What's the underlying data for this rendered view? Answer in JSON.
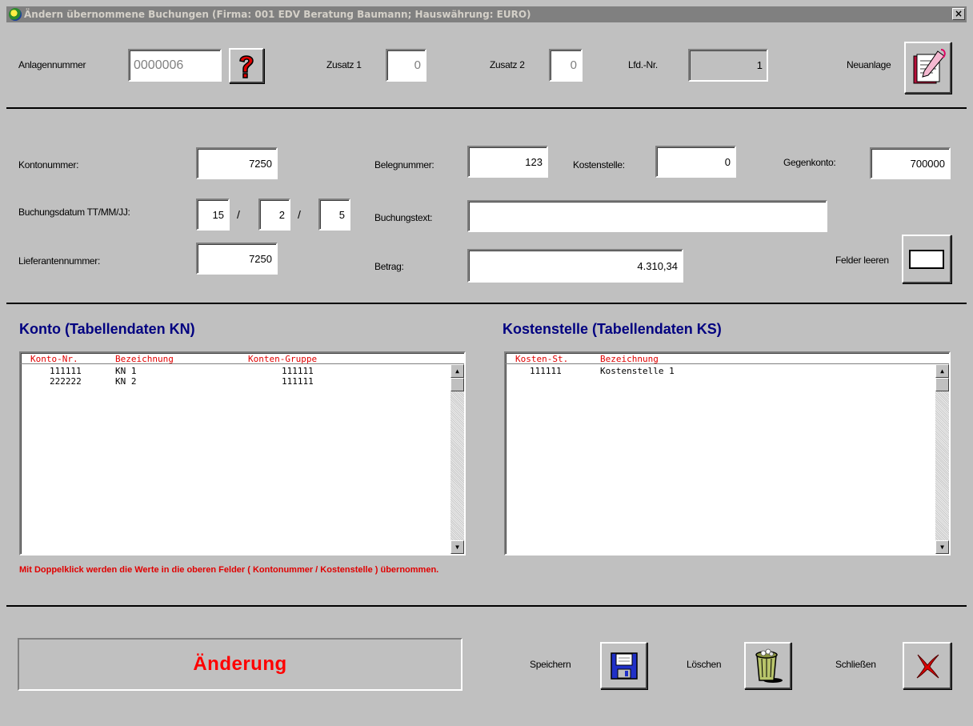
{
  "window": {
    "title": "Ändern übernommene Buchungen  (Firma: 001 EDV Beratung Baumann;  Hauswährung: EURO)",
    "close_label": "×"
  },
  "header": {
    "anlagennummer_label": "Anlagennummer",
    "anlagennummer_value": "0000006",
    "zusatz1_label": "Zusatz 1",
    "zusatz1_value": "0",
    "zusatz2_label": "Zusatz 2",
    "zusatz2_value": "0",
    "lfd_label": "Lfd.-Nr.",
    "lfd_value": "1",
    "neuanlage_label": "Neuanlage"
  },
  "booking": {
    "kontonummer_label": "Kontonummer:",
    "kontonummer_value": "7250",
    "belegnummer_label": "Belegnummer:",
    "belegnummer_value": "123",
    "kostenstelle_label": "Kostenstelle:",
    "kostenstelle_value": "0",
    "gegenkonto_label": "Gegenkonto:",
    "gegenkonto_value": "700000",
    "buchungsdatum_label": "Buchungsdatum TT/MM/JJ:",
    "date_day": "15",
    "date_month": "2",
    "date_year": "5",
    "date_sep": "/",
    "buchungstext_label": "Buchungstext:",
    "buchungstext_value": "",
    "lieferantennummer_label": "Lieferantennummer:",
    "lieferantennummer_value": "7250",
    "betrag_label": "Betrag:",
    "betrag_value": "4.310,34",
    "felder_leeren_label": "Felder leeren"
  },
  "konto": {
    "title": "Konto (Tabellendaten KN)",
    "columns": [
      "Konto-Nr.",
      "Bezeichnung",
      "Konten-Gruppe"
    ],
    "rows": [
      [
        "111111",
        "KN 1",
        "111111"
      ],
      [
        "222222",
        "KN 2",
        "111111"
      ]
    ]
  },
  "kostenstelle": {
    "title": "Kostenstelle (Tabellendaten KS)",
    "columns": [
      "Kosten-St.",
      "Bezeichnung"
    ],
    "rows": [
      [
        "111111",
        "Kostenstelle 1"
      ]
    ]
  },
  "hint": "Mit Doppelklick werden die Werte in die oberen Felder ( Kontonummer / Kostenstelle ) übernommen.",
  "footer": {
    "status": "Änderung",
    "speichern_label": "Speichern",
    "loeschen_label": "Löschen",
    "schliessen_label": "Schließen"
  },
  "colors": {
    "accent_red": "#e00000",
    "section_title_blue": "#000080",
    "background": "#c0c0c0"
  },
  "icons": {
    "help": "question-mark-icon",
    "neuanlage": "notebook-pen-icon",
    "felder_leeren": "blank-field-icon",
    "speichern": "floppy-disk-icon",
    "loeschen": "trash-can-icon",
    "schliessen": "red-x-icon"
  }
}
